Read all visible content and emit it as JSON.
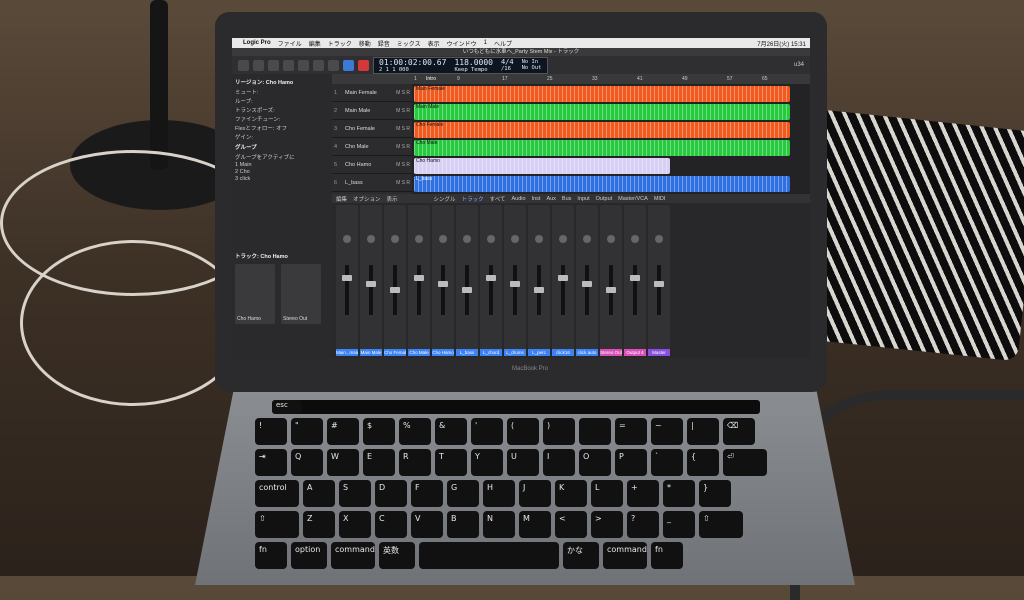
{
  "menubar": {
    "apple": "",
    "app": "Logic Pro",
    "items": [
      "ファイル",
      "編集",
      "トラック",
      "移動",
      "録音",
      "ミックス",
      "表示",
      "ウインドウ",
      "1",
      "ヘルプ"
    ],
    "clock": "7月26日(火) 15:31"
  },
  "window_title": "いつもどもに水車へ_Party Stem Mix - トラック",
  "transport": {
    "position_smpte": "01:00:02:00.67",
    "position_bars": "2 1 1 000",
    "tempo": "118.0000",
    "tempo_label": "Keep Tempo",
    "signature": "4/4",
    "division": "/16",
    "in_label": "No In",
    "out_label": "No Out",
    "cpu": "u34"
  },
  "inspector": {
    "region_header": "リージョン: Cho Hamo",
    "lines": [
      "ミュート:",
      "ループ:",
      "トランスポーズ:",
      "ファインチューン:",
      "Flexとフォロー: オフ",
      "ゲイン:"
    ],
    "group_header": "グループ",
    "group_toggle": "グループをアクティブに",
    "groups": [
      {
        "num": "1",
        "name": "Main"
      },
      {
        "num": "2",
        "name": "Cho"
      },
      {
        "num": "3",
        "name": "click"
      }
    ],
    "track_header": "トラック: Cho Hamo",
    "strip_left": "Cho Hamo",
    "strip_right": "Stereo Out"
  },
  "ruler_marks": [
    "1",
    "9",
    "17",
    "25",
    "33",
    "41",
    "49",
    "57",
    "65"
  ],
  "ruler_marker": "Intro",
  "tracks": [
    {
      "num": "1",
      "name": "Main Female",
      "region": "Main Female",
      "color": "#f05a1e"
    },
    {
      "num": "2",
      "name": "Main Male",
      "region": "Main Male",
      "color": "#27c93f"
    },
    {
      "num": "3",
      "name": "Cho Female",
      "region": "Cho Female",
      "color": "#f05a1e"
    },
    {
      "num": "4",
      "name": "Cho Male",
      "region": "Cho Male",
      "color": "#27c93f"
    },
    {
      "num": "5",
      "name": "Cho Hamo",
      "region": "Cho Hamo",
      "color": "#d8cff5"
    },
    {
      "num": "6",
      "name": "L_bass",
      "region": "L_bass",
      "color": "#2f6fe0"
    }
  ],
  "mixer": {
    "menus": [
      "編集",
      "オプション",
      "表示"
    ],
    "views": [
      "シングル",
      "トラック",
      "すべて",
      "Audio",
      "Inst",
      "Aux",
      "Bus",
      "Input",
      "Output",
      "Master/VCA",
      "MIDI"
    ],
    "active_view": "トラック",
    "strips": [
      {
        "name": "Main...male",
        "color": "#3b82f6"
      },
      {
        "name": "Main Male",
        "color": "#3b82f6"
      },
      {
        "name": "Cho Female",
        "color": "#3b82f6"
      },
      {
        "name": "Cho Male",
        "color": "#3b82f6"
      },
      {
        "name": "Cho Hamo",
        "color": "#3b82f6"
      },
      {
        "name": "L_bass",
        "color": "#3b82f6"
      },
      {
        "name": "L_chord",
        "color": "#3b82f6"
      },
      {
        "name": "L_drums",
        "color": "#3b82f6"
      },
      {
        "name": "L_perc",
        "color": "#3b82f6"
      },
      {
        "name": "click16",
        "color": "#3b82f6"
      },
      {
        "name": "click auto",
        "color": "#3b82f6"
      },
      {
        "name": "Stereo Out",
        "color": "#d94fb8"
      },
      {
        "name": "Output 4",
        "color": "#d94fb8"
      },
      {
        "name": "Master",
        "color": "#8a4fe0"
      }
    ]
  },
  "keyboard": {
    "esc": "esc",
    "row1": [
      "!",
      "\"",
      "#",
      "$",
      "%",
      "&",
      "'",
      "(",
      ")",
      "",
      "=",
      "~",
      "|",
      "⌫"
    ],
    "row2": [
      "⇥",
      "Q",
      "W",
      "E",
      "R",
      "T",
      "Y",
      "U",
      "I",
      "O",
      "P",
      "`",
      "{",
      "⏎"
    ],
    "row3": [
      "control",
      "A",
      "S",
      "D",
      "F",
      "G",
      "H",
      "J",
      "K",
      "L",
      "+",
      "*",
      "}"
    ],
    "row4": [
      "⇧",
      "Z",
      "X",
      "C",
      "V",
      "B",
      "N",
      "M",
      "<",
      ">",
      "?",
      "_",
      "⇧"
    ],
    "row5": [
      "fn",
      "option",
      "command",
      "英数",
      "",
      "かな",
      "command",
      "fn"
    ]
  }
}
